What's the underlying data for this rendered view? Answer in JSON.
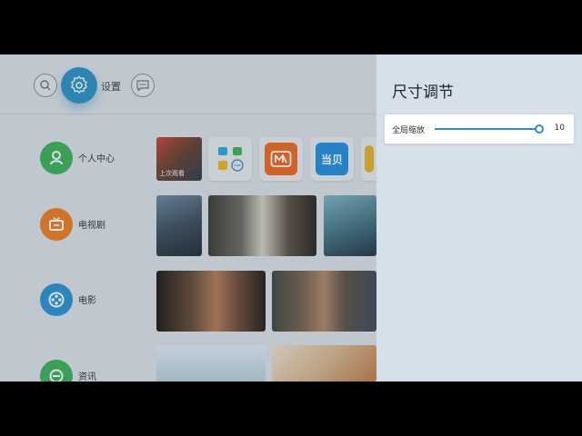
{
  "header": {
    "settings_label": "设置"
  },
  "sidebar": {
    "items": [
      {
        "label": "个人中心",
        "icon": "user-icon",
        "color": "#3cb35a"
      },
      {
        "label": "电视剧",
        "icon": "tv-icon",
        "color": "#ee7f22"
      },
      {
        "label": "电影",
        "icon": "film-reel-icon",
        "color": "#2a93d6"
      },
      {
        "label": "资讯",
        "icon": "news-icon",
        "color": "#3cb35a"
      }
    ]
  },
  "content": {
    "row1": {
      "history_caption": "上次观看",
      "apps": [
        {
          "name": "app-folder"
        },
        {
          "name": "mango-tv",
          "color": "#f06a22"
        },
        {
          "name": "dangbei",
          "text": "当贝",
          "color": "#1f8fe0"
        }
      ]
    }
  },
  "panel": {
    "title": "尺寸调节",
    "slider": {
      "label": "全局缩放",
      "value": "10",
      "fraction": 1.0
    }
  },
  "colors": {
    "accent": "#2a93c7",
    "panel_bg": "#d6e0eb"
  }
}
